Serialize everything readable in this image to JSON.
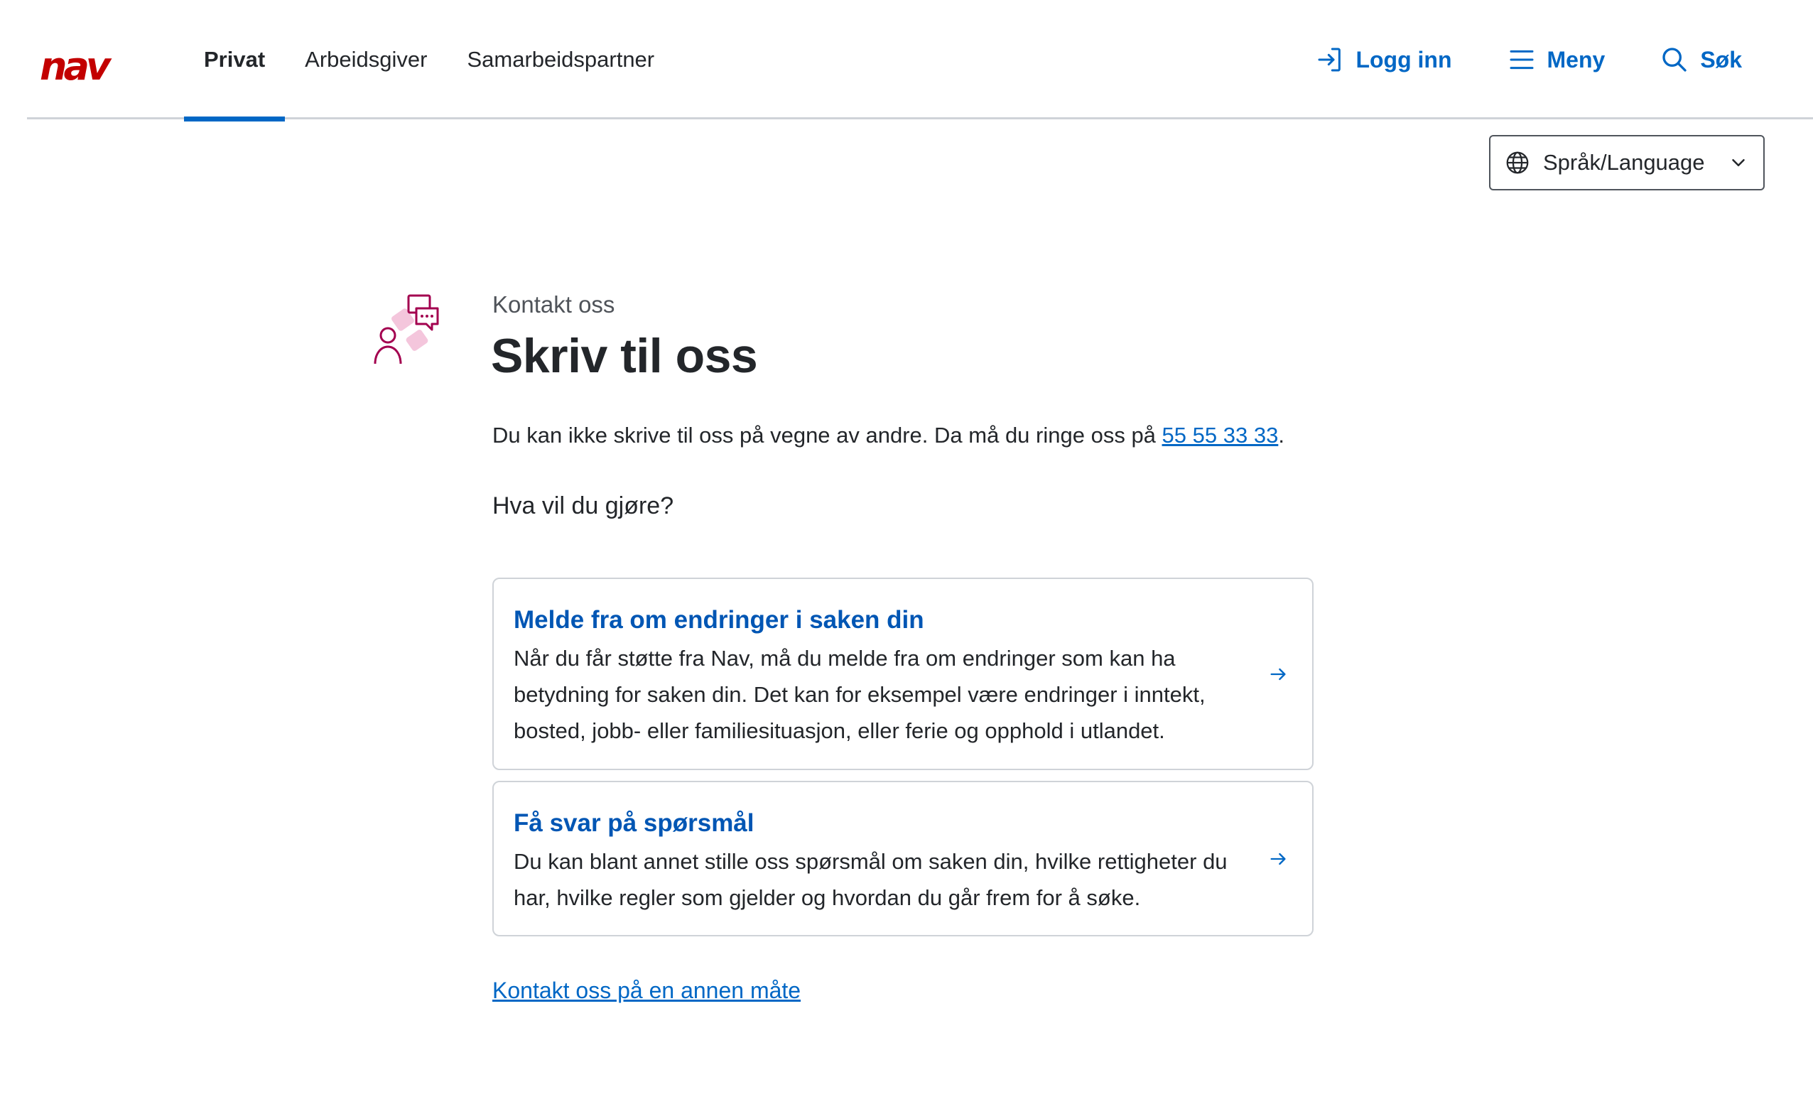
{
  "header": {
    "logo_text": "nav",
    "tabs": [
      {
        "label": "Privat",
        "active": true
      },
      {
        "label": "Arbeidsgiver",
        "active": false
      },
      {
        "label": "Samarbeidspartner",
        "active": false
      }
    ],
    "login_label": "Logg inn",
    "menu_label": "Meny",
    "search_label": "Søk"
  },
  "language": {
    "label": "Språk/Language"
  },
  "page": {
    "kicker": "Kontakt oss",
    "title": "Skriv til oss",
    "intro_text": "Du kan ikke skrive til oss på vegne av andre. Da må du ringe oss på ",
    "phone": "55 55 33 33",
    "intro_end": ".",
    "question": "Hva vil du gjøre?",
    "cards": [
      {
        "title": "Melde fra om endringer i saken din",
        "description": "Når du får støtte fra Nav, må du melde fra om endringer som kan ha betydning for saken din. Det kan for eksempel være endringer i inntekt, bosted, jobb- eller familiesituasjon, eller ferie og opphold i utlandet."
      },
      {
        "title": "Få svar på spørsmål",
        "description": "Du kan blant annet stille oss spørsmål om saken din, hvilke rettigheter du har, hvilke regler som gjelder og hvordan du går frem for å søke."
      }
    ],
    "other_contact_link": "Kontakt oss på en annen måte"
  },
  "colors": {
    "accent": "#0067c5",
    "brand": "#c30000",
    "illustration": "#a3004f"
  }
}
